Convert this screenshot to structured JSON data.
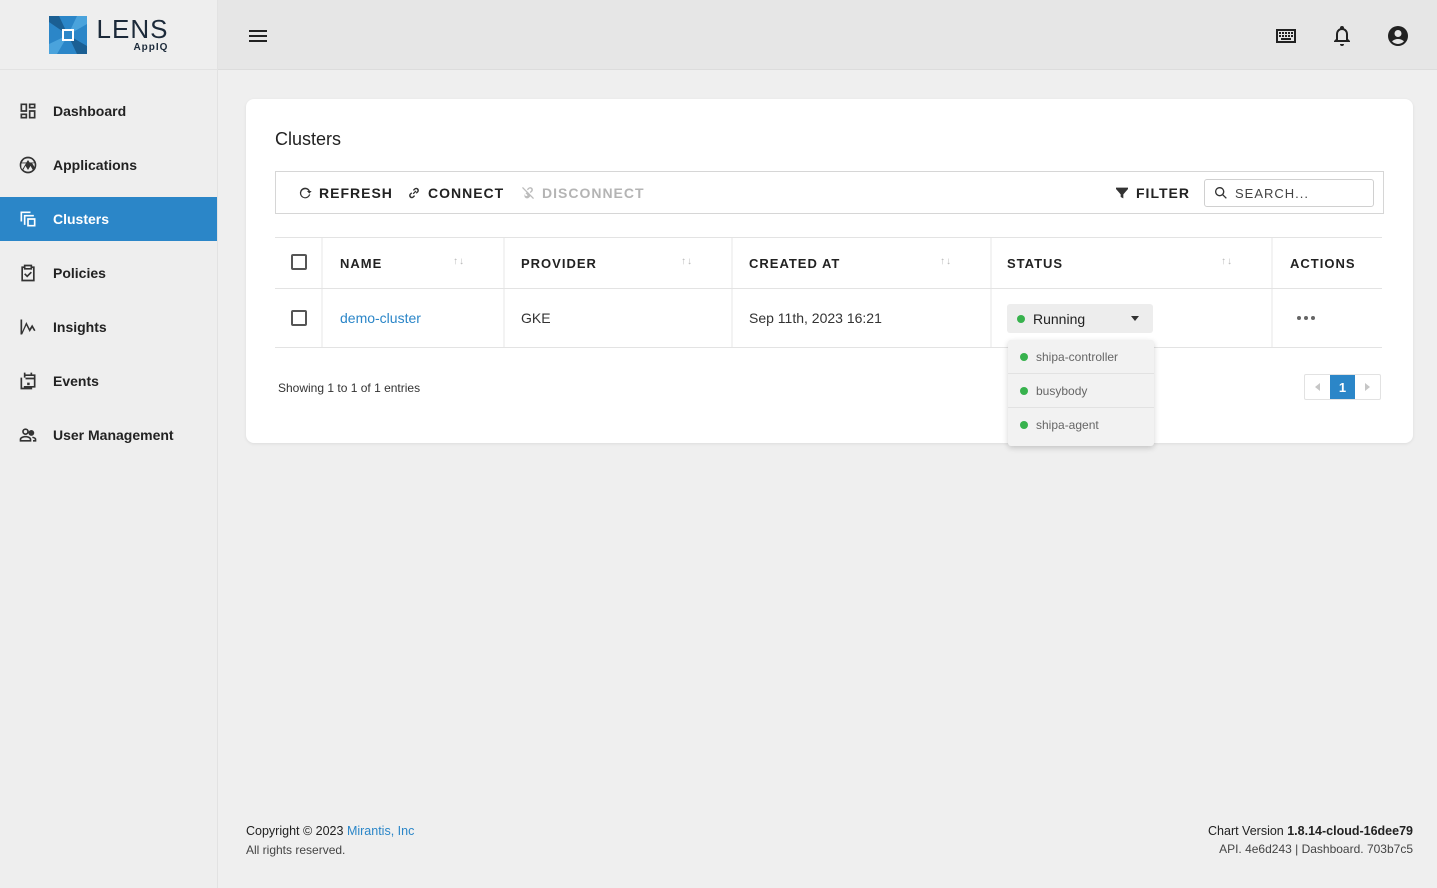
{
  "brand": {
    "name": "LENS",
    "sub": "AppIQ",
    "accent": "#2b86c8"
  },
  "sidebar": {
    "items": [
      {
        "label": "Dashboard",
        "icon": "dashboard-icon",
        "active": false
      },
      {
        "label": "Applications",
        "icon": "applications-icon",
        "active": false
      },
      {
        "label": "Clusters",
        "icon": "clusters-icon",
        "active": true
      },
      {
        "label": "Policies",
        "icon": "policies-icon",
        "active": false
      },
      {
        "label": "Insights",
        "icon": "insights-icon",
        "active": false
      },
      {
        "label": "Events",
        "icon": "events-icon",
        "active": false
      },
      {
        "label": "User Management",
        "icon": "users-icon",
        "active": false
      }
    ]
  },
  "topbar": {
    "icons": [
      "menu-icon",
      "keyboard-icon",
      "bell-icon",
      "account-icon"
    ]
  },
  "page": {
    "title": "Clusters"
  },
  "toolbar": {
    "refresh": "REFRESH",
    "connect": "CONNECT",
    "disconnect": "DISCONNECT",
    "filter": "FILTER",
    "search_placeholder": "SEARCH..."
  },
  "table": {
    "columns": [
      "NAME",
      "PROVIDER",
      "CREATED AT",
      "STATUS",
      "ACTIONS"
    ],
    "sort_glyph": "↑↓",
    "rows": [
      {
        "name": "demo-cluster",
        "provider": "GKE",
        "created_at": "Sep 11th, 2023 16:21",
        "status": "Running"
      }
    ]
  },
  "status_dropdown": {
    "items": [
      "shipa-controller",
      "busybody",
      "shipa-agent"
    ],
    "dot_color": "#37b24d"
  },
  "pagination": {
    "showing": "Showing 1 to 1 of 1 entries",
    "current_page": "1"
  },
  "footer": {
    "copyright_prefix": "Copyright © 2023",
    "company": "Mirantis, Inc",
    "rights": "All rights reserved.",
    "chart_version_label": "Chart Version",
    "chart_version": "1.8.14-cloud-16dee79",
    "api_line": "API. 4e6d243 | Dashboard. 703b7c5"
  }
}
